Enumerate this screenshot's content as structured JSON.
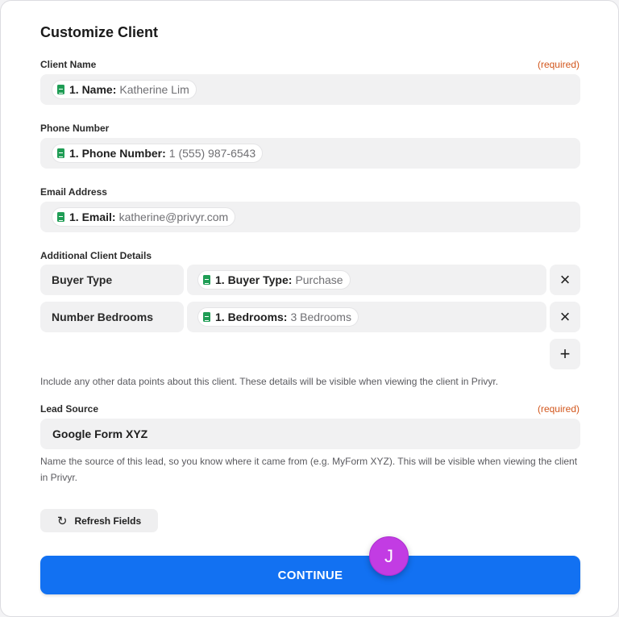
{
  "title": "Customize Client",
  "required_text": "(required)",
  "client_name": {
    "label": "Client Name",
    "key": "1. Name:",
    "value": "Katherine Lim"
  },
  "phone": {
    "label": "Phone Number",
    "key": "1. Phone Number:",
    "value": "1 (555) 987-6543"
  },
  "email": {
    "label": "Email Address",
    "key": "1. Email:",
    "value": "katherine@privyr.com"
  },
  "details": {
    "label": "Additional Client Details",
    "rows": [
      {
        "name": "Buyer Type",
        "key": "1. Buyer Type:",
        "value": "Purchase"
      },
      {
        "name": "Number Bedrooms",
        "key": "1. Bedrooms:",
        "value": "3 Bedrooms"
      }
    ],
    "remove_icon": "×",
    "add_icon": "+",
    "help": "Include any other data points about this client. These details will be visible when viewing the client in Privyr."
  },
  "lead_source": {
    "label": "Lead Source",
    "value": "Google Form XYZ",
    "help": "Name the source of this lead, so you know where it came from (e.g. MyForm XYZ). This will be visible when viewing the client in Privyr."
  },
  "refresh_label": "Refresh Fields",
  "refresh_icon": "↻",
  "continue_label": "CONTINUE",
  "avatar_letter": "J",
  "colors": {
    "primary": "#1271f2",
    "required": "#d2561c",
    "avatar": "#c23ce3",
    "sheet": "#1f9d55"
  }
}
